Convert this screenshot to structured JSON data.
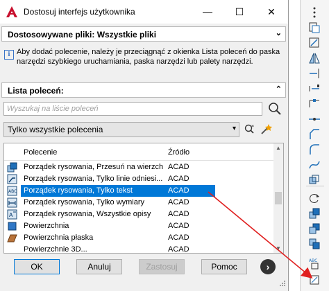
{
  "window": {
    "title": "Dostosuj interfejs użytkownika",
    "minimize_glyph": "—",
    "maximize_glyph": "☐",
    "close_glyph": "✕"
  },
  "customize_files": {
    "label": "Dostosowywane pliki: Wszystkie pliki"
  },
  "info": {
    "text": "Aby dodać polecenie, należy je przeciągnąć z okienka Lista poleceń do paska narzędzi szybkiego uruchamiania, paska narzędzi lub palety narzędzi."
  },
  "command_list": {
    "label": "Lista poleceń:",
    "search_placeholder": "Wyszukaj na liście poleceń",
    "filter_value": "Tylko wszystkie polecenia",
    "columns": {
      "command": "Polecenie",
      "source": "Źródło"
    },
    "rows": [
      {
        "command": "Porządek rysowania, Przesuń na wierzch",
        "source": "ACAD",
        "icon": "draworder-front-icon"
      },
      {
        "command": "Porządek rysowania, Tylko linie odniesi...",
        "source": "ACAD",
        "icon": "draworder-leaders-icon"
      },
      {
        "command": "Porządek rysowania, Tylko tekst",
        "source": "ACAD",
        "icon": "draworder-text-icon"
      },
      {
        "command": "Porządek rysowania, Tylko wymiary",
        "source": "ACAD",
        "icon": "draworder-dimensions-icon"
      },
      {
        "command": "Porządek rysowania, Wszystkie opisy",
        "source": "ACAD",
        "icon": "draworder-annotations-icon"
      },
      {
        "command": "Powierzchnia",
        "source": "ACAD",
        "icon": "surface-icon"
      },
      {
        "command": "Powierzchnia płaska",
        "source": "ACAD",
        "icon": "planar-surface-icon"
      },
      {
        "command": "Powierzchnie 3D...",
        "source": "ACAD",
        "icon": "3d-surfaces-icon"
      }
    ],
    "selected_index": 2
  },
  "buttons": {
    "ok": "OK",
    "cancel": "Anuluj",
    "apply": "Zastosuj",
    "help": "Pomoc",
    "more": "›"
  },
  "colors": {
    "selection": "#0078d7",
    "annotation_arrow": "#e02020",
    "app_icon": "#c8102e"
  }
}
